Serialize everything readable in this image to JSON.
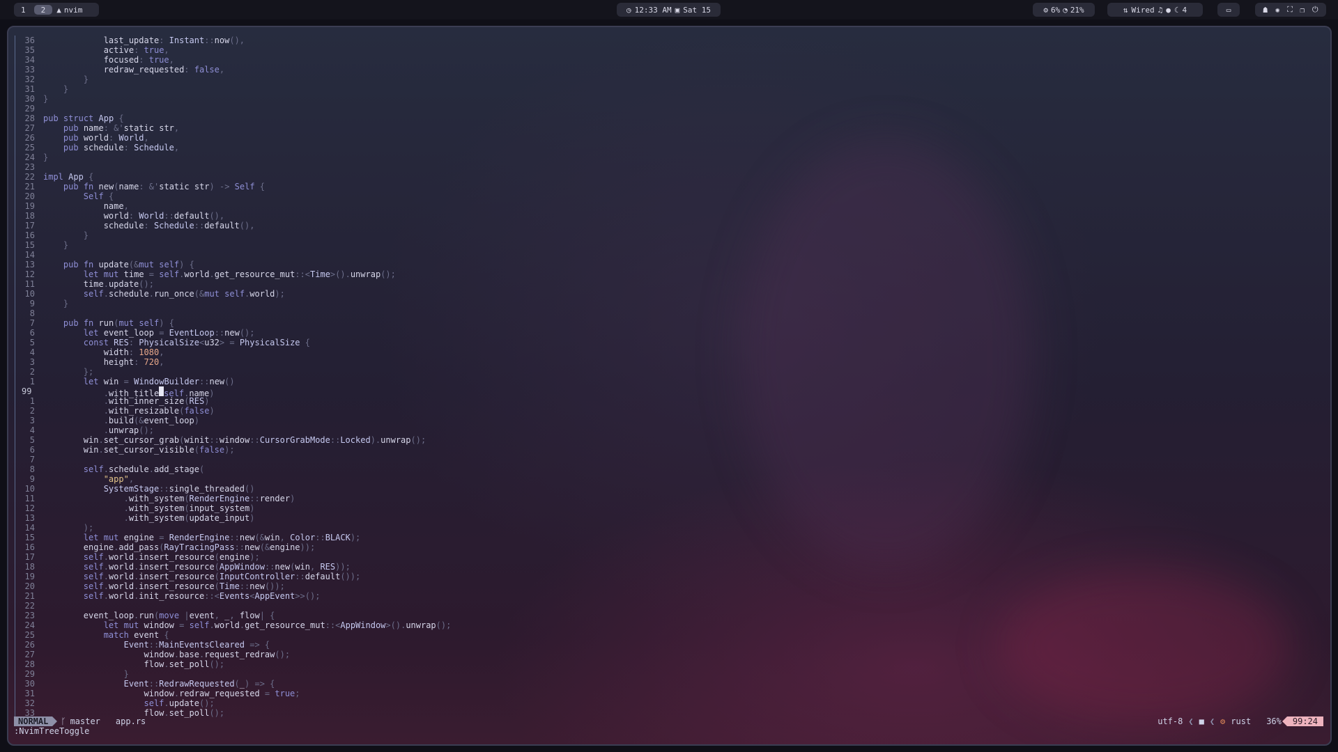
{
  "topbar": {
    "workspaces": [
      "1",
      "2"
    ],
    "active_workspace": "2",
    "app_label": "nvim",
    "clock_time": "12:33 AM",
    "clock_date": "Sat 15",
    "cpu": "6%",
    "mem": "21%",
    "network": "Wired",
    "volume": "4"
  },
  "editor": {
    "mode": "NORMAL",
    "branch": "master",
    "file": "app.rs",
    "encoding": "utf-8",
    "filetype": "rust",
    "percent": "36%",
    "position": "99:24",
    "command": ":NvimTreeToggle",
    "cursor_line_number": "99",
    "lines": [
      {
        "n": "36",
        "t": "            last_update: Instant::now(),"
      },
      {
        "n": "35",
        "t": "            active: true,"
      },
      {
        "n": "34",
        "t": "            focused: true,"
      },
      {
        "n": "33",
        "t": "            redraw_requested: false,"
      },
      {
        "n": "32",
        "t": "        }"
      },
      {
        "n": "31",
        "t": "    }"
      },
      {
        "n": "30",
        "t": "}"
      },
      {
        "n": "29",
        "t": ""
      },
      {
        "n": "28",
        "t": "pub struct App {"
      },
      {
        "n": "27",
        "t": "    pub name: &'static str,"
      },
      {
        "n": "26",
        "t": "    pub world: World,"
      },
      {
        "n": "25",
        "t": "    pub schedule: Schedule,"
      },
      {
        "n": "24",
        "t": "}"
      },
      {
        "n": "23",
        "t": ""
      },
      {
        "n": "22",
        "t": "impl App {"
      },
      {
        "n": "21",
        "t": "    pub fn new(name: &'static str) -> Self {"
      },
      {
        "n": "20",
        "t": "        Self {"
      },
      {
        "n": "19",
        "t": "            name,"
      },
      {
        "n": "18",
        "t": "            world: World::default(),"
      },
      {
        "n": "17",
        "t": "            schedule: Schedule::default(),"
      },
      {
        "n": "16",
        "t": "        }"
      },
      {
        "n": "15",
        "t": "    }"
      },
      {
        "n": "14",
        "t": ""
      },
      {
        "n": "13",
        "t": "    pub fn update(&mut self) {"
      },
      {
        "n": "12",
        "t": "        let mut time = self.world.get_resource_mut::<Time>().unwrap();"
      },
      {
        "n": "11",
        "t": "        time.update();"
      },
      {
        "n": "10",
        "t": "        self.schedule.run_once(&mut self.world);"
      },
      {
        "n": "9",
        "t": "    }"
      },
      {
        "n": "8",
        "t": ""
      },
      {
        "n": "7",
        "t": "    pub fn run(mut self) {"
      },
      {
        "n": "6",
        "t": "        let event_loop = EventLoop::new();"
      },
      {
        "n": "5",
        "t": "        const RES: PhysicalSize<u32> = PhysicalSize {"
      },
      {
        "n": "4",
        "t": "            width: 1080,"
      },
      {
        "n": "3",
        "t": "            height: 720,"
      },
      {
        "n": "2",
        "t": "        };"
      },
      {
        "n": "1",
        "t": "        let win = WindowBuilder::new()"
      },
      {
        "n": "99",
        "t": "            .with_title(self.name)",
        "cur": true
      },
      {
        "n": "1",
        "t": "            .with_inner_size(RES)"
      },
      {
        "n": "2",
        "t": "            .with_resizable(false)"
      },
      {
        "n": "3",
        "t": "            .build(&event_loop)"
      },
      {
        "n": "4",
        "t": "            .unwrap();"
      },
      {
        "n": "5",
        "t": "        win.set_cursor_grab(winit::window::CursorGrabMode::Locked).unwrap();"
      },
      {
        "n": "6",
        "t": "        win.set_cursor_visible(false);"
      },
      {
        "n": "7",
        "t": ""
      },
      {
        "n": "8",
        "t": "        self.schedule.add_stage("
      },
      {
        "n": "9",
        "t": "            \"app\","
      },
      {
        "n": "10",
        "t": "            SystemStage::single_threaded()"
      },
      {
        "n": "11",
        "t": "                .with_system(RenderEngine::render)"
      },
      {
        "n": "12",
        "t": "                .with_system(input_system)"
      },
      {
        "n": "13",
        "t": "                .with_system(update_input)"
      },
      {
        "n": "14",
        "t": "        );"
      },
      {
        "n": "15",
        "t": "        let mut engine = RenderEngine::new(&win, Color::BLACK);"
      },
      {
        "n": "16",
        "t": "        engine.add_pass(RayTracingPass::new(&engine));"
      },
      {
        "n": "17",
        "t": "        self.world.insert_resource(engine);"
      },
      {
        "n": "18",
        "t": "        self.world.insert_resource(AppWindow::new(win, RES));"
      },
      {
        "n": "19",
        "t": "        self.world.insert_resource(InputController::default());"
      },
      {
        "n": "20",
        "t": "        self.world.insert_resource(Time::new());"
      },
      {
        "n": "21",
        "t": "        self.world.init_resource::<Events<AppEvent>>();"
      },
      {
        "n": "22",
        "t": ""
      },
      {
        "n": "23",
        "t": "        event_loop.run(move |event, _, flow| {"
      },
      {
        "n": "24",
        "t": "            let mut window = self.world.get_resource_mut::<AppWindow>().unwrap();"
      },
      {
        "n": "25",
        "t": "            match event {"
      },
      {
        "n": "26",
        "t": "                Event::MainEventsCleared => {"
      },
      {
        "n": "27",
        "t": "                    window.base.request_redraw();"
      },
      {
        "n": "28",
        "t": "                    flow.set_poll();"
      },
      {
        "n": "29",
        "t": "                }"
      },
      {
        "n": "30",
        "t": "                Event::RedrawRequested(_) => {"
      },
      {
        "n": "31",
        "t": "                    window.redraw_requested = true;"
      },
      {
        "n": "32",
        "t": "                    self.update();"
      },
      {
        "n": "33",
        "t": "                    flow.set_poll();"
      }
    ]
  }
}
